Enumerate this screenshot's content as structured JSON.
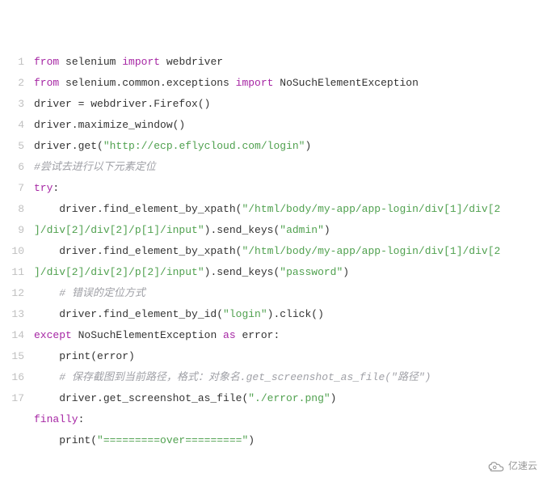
{
  "lines": [
    {
      "n": "1",
      "segs": [
        {
          "t": "from",
          "c": "kw"
        },
        {
          "t": " selenium "
        },
        {
          "t": "import",
          "c": "kw"
        },
        {
          "t": " webdriver"
        }
      ]
    },
    {
      "n": "2",
      "segs": [
        {
          "t": "from",
          "c": "kw"
        },
        {
          "t": " selenium.common.exceptions "
        },
        {
          "t": "import",
          "c": "kw"
        },
        {
          "t": " NoSuchElementException"
        }
      ]
    },
    {
      "n": "3",
      "segs": [
        {
          "t": "driver = webdriver.Firefox()"
        }
      ]
    },
    {
      "n": "4",
      "segs": [
        {
          "t": "driver.maximize_window()"
        }
      ]
    },
    {
      "n": "5",
      "segs": [
        {
          "t": "driver.get("
        },
        {
          "t": "\"http://ecp.eflycloud.com/login\"",
          "c": "str"
        },
        {
          "t": ")"
        }
      ]
    },
    {
      "n": "6",
      "segs": [
        {
          "t": "#尝试去进行以下元素定位",
          "c": "cmt"
        }
      ]
    },
    {
      "n": "7",
      "segs": [
        {
          "t": "try",
          "c": "kw"
        },
        {
          "t": ":"
        }
      ]
    },
    {
      "n": "8",
      "segs": [
        {
          "t": "    driver.find_element_by_xpath("
        },
        {
          "t": "\"/html/body/my-app/app-login/div[1]/div[2",
          "c": "str"
        }
      ]
    },
    {
      "n": "9",
      "segs": [
        {
          "t": "]/div[2]/div[2]/p[1]/input\"",
          "c": "str"
        },
        {
          "t": ").send_keys("
        },
        {
          "t": "\"admin\"",
          "c": "str"
        },
        {
          "t": ")"
        }
      ]
    },
    {
      "n": "10",
      "segs": [
        {
          "t": "    driver.find_element_by_xpath("
        },
        {
          "t": "\"/html/body/my-app/app-login/div[1]/div[2",
          "c": "str"
        }
      ]
    },
    {
      "n": "11",
      "segs": [
        {
          "t": "]/div[2]/div[2]/p[2]/input\"",
          "c": "str"
        },
        {
          "t": ").send_keys("
        },
        {
          "t": "\"password\"",
          "c": "str"
        },
        {
          "t": ")"
        }
      ]
    },
    {
      "n": "12",
      "segs": [
        {
          "t": "    "
        },
        {
          "t": "# 错误的定位方式",
          "c": "cmt"
        }
      ]
    },
    {
      "n": "13",
      "segs": [
        {
          "t": "    driver.find_element_by_id("
        },
        {
          "t": "\"login\"",
          "c": "str"
        },
        {
          "t": ").click()"
        }
      ]
    },
    {
      "n": "14",
      "segs": [
        {
          "t": "except",
          "c": "kw"
        },
        {
          "t": " NoSuchElementException "
        },
        {
          "t": "as",
          "c": "kw"
        },
        {
          "t": " error:"
        }
      ]
    },
    {
      "n": "15",
      "segs": [
        {
          "t": "    print(error)"
        }
      ]
    },
    {
      "n": "16",
      "segs": [
        {
          "t": "    "
        },
        {
          "t": "# 保存截图到当前路径，格式：对象名.get_screenshot_as_file(\"路径\")",
          "c": "cmt"
        }
      ]
    },
    {
      "n": "17",
      "segs": [
        {
          "t": "    driver.get_screenshot_as_file("
        },
        {
          "t": "\"./error.png\"",
          "c": "str"
        },
        {
          "t": ")"
        }
      ]
    },
    {
      "n": "",
      "segs": [
        {
          "t": "finally",
          "c": "kw"
        },
        {
          "t": ":"
        }
      ]
    },
    {
      "n": "",
      "segs": [
        {
          "t": "    print("
        },
        {
          "t": "\"=========over=========\"",
          "c": "str"
        },
        {
          "t": ")"
        }
      ]
    }
  ],
  "logo_text": "亿速云"
}
